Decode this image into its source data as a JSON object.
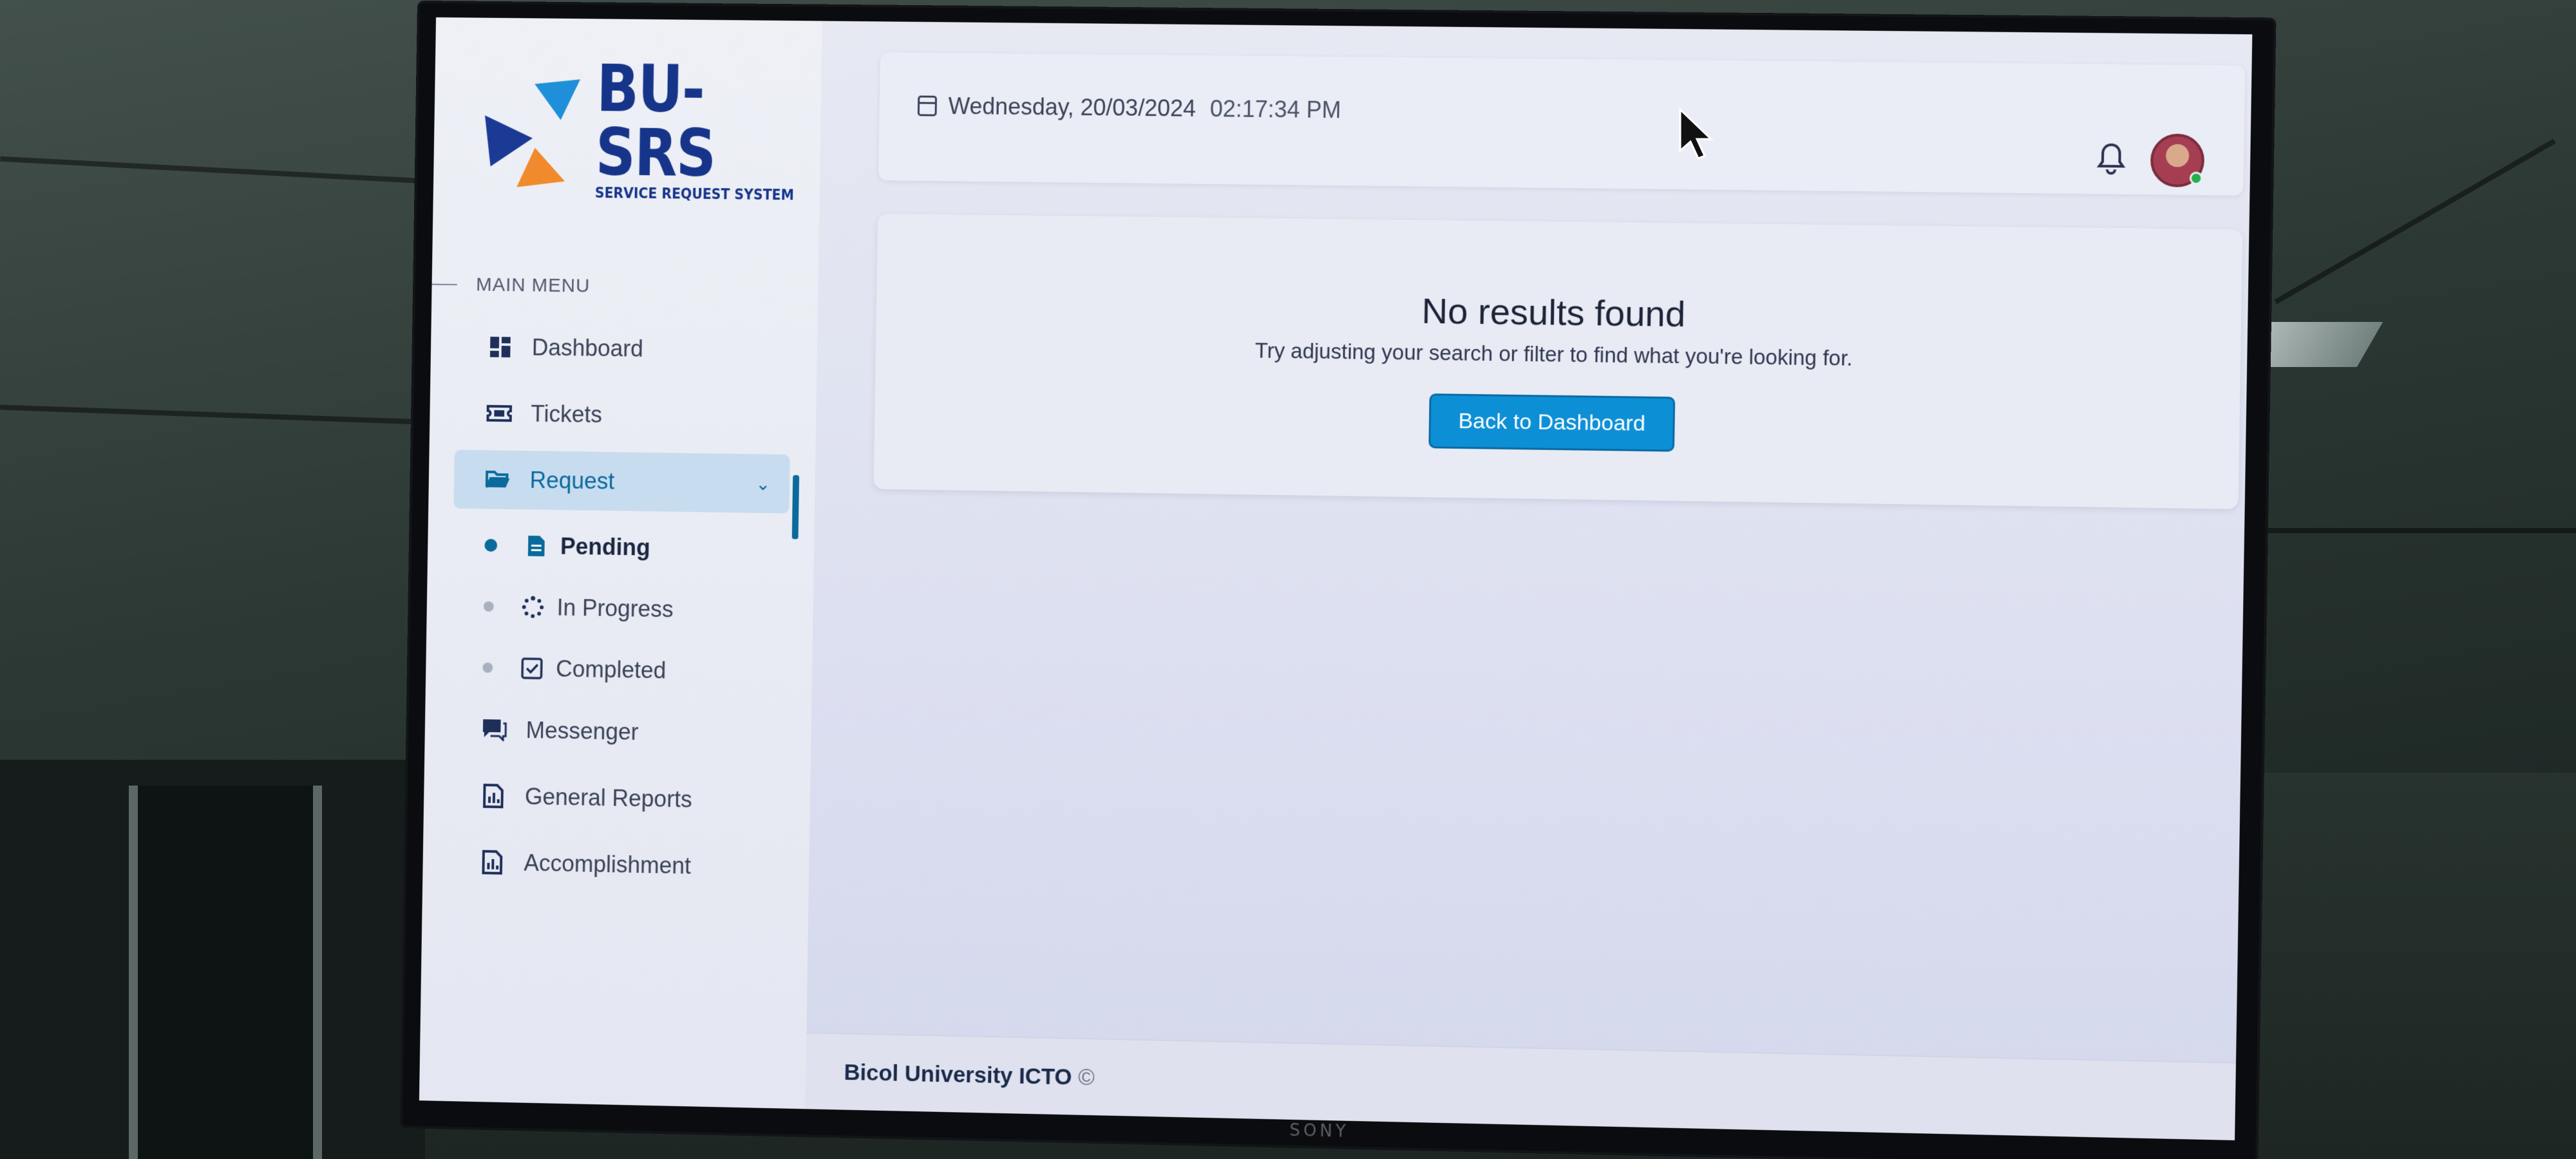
{
  "app": {
    "logo_title": "BU-SRS",
    "logo_subtitle": "SERVICE REQUEST SYSTEM",
    "monitor_brand": "SONY"
  },
  "sidebar": {
    "section_label": "MAIN MENU",
    "items": [
      {
        "label": "Dashboard",
        "icon": "dashboard-grid-icon"
      },
      {
        "label": "Tickets",
        "icon": "ticket-icon"
      },
      {
        "label": "Request",
        "icon": "folder-open-icon",
        "active": true,
        "expanded": true
      },
      {
        "label": "Messenger",
        "icon": "chat-icon"
      },
      {
        "label": "General Reports",
        "icon": "report-file-icon"
      },
      {
        "label": "Accomplishment",
        "icon": "accomplishment-file-icon"
      }
    ],
    "request_sub": [
      {
        "label": "Pending",
        "icon": "document-icon",
        "active": true
      },
      {
        "label": "In Progress",
        "icon": "spinner-icon"
      },
      {
        "label": "Completed",
        "icon": "checkbox-icon"
      }
    ]
  },
  "header": {
    "date": "Wednesday, 20/03/2024",
    "time": "02:17:34 PM"
  },
  "empty_state": {
    "title": "No results found",
    "message": "Try adjusting your search or filter to find what you're looking for.",
    "button_label": "Back to Dashboard"
  },
  "footer": {
    "text": "Bicol University ICTO",
    "copyright_symbol": "©"
  },
  "colors": {
    "brand_blue": "#16358a",
    "accent": "#0d8fd6",
    "active_text": "#0a6a9c",
    "logo_orange": "#f08a2c"
  }
}
